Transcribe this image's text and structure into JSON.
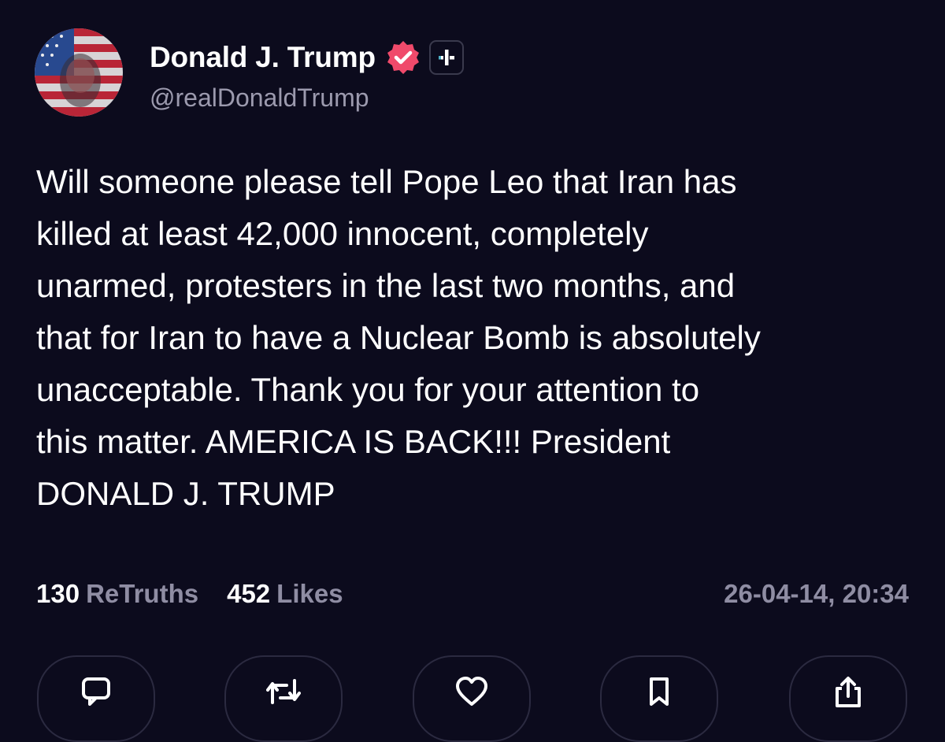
{
  "post": {
    "author": {
      "display_name": "Donald J. Trump",
      "handle": "@realDonaldTrump",
      "verified_icon": "verified-badge-icon",
      "badge_icon": "plus-badge-icon",
      "avatar": "flag-portrait-avatar"
    },
    "text_lines": [
      "Will someone please tell Pope Leo that Iran has",
      "killed at least 42,000 innocent, completely",
      "unarmed, protesters in the last two months, and",
      "that for Iran to have a Nuclear Bomb is absolutely",
      "unacceptable. Thank you for your attention to",
      "this matter. AMERICA IS BACK!!! President",
      "DONALD J. TRUMP"
    ],
    "stats": {
      "retruths_count": "130",
      "retruths_label": "ReTruths",
      "likes_count": "452",
      "likes_label": "Likes"
    },
    "timestamp": "26-04-14, 20:34"
  },
  "actions": [
    {
      "name": "reply",
      "icon": "comment-icon"
    },
    {
      "name": "retruth",
      "icon": "repost-icon"
    },
    {
      "name": "like",
      "icon": "heart-icon"
    },
    {
      "name": "bookmark",
      "icon": "bookmark-icon"
    },
    {
      "name": "share",
      "icon": "share-icon"
    }
  ],
  "colors": {
    "background": "#0c0b1d",
    "text": "#ffffff",
    "muted": "#8f8da3",
    "verified": "#f04a6b",
    "button_border": "#2b2a40"
  }
}
